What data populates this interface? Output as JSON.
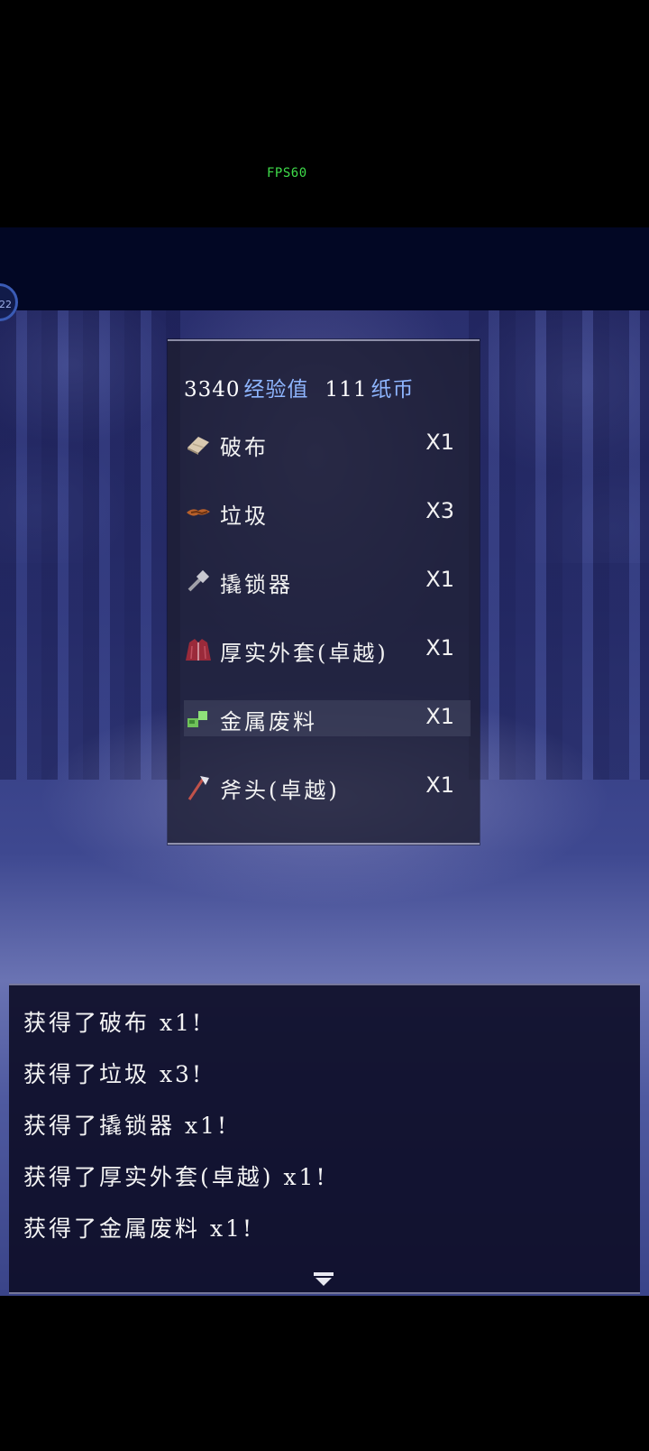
{
  "hud": {
    "fps": "FPS60",
    "menu_badge": "22"
  },
  "rewards": {
    "exp_value": "3340",
    "exp_label": "经验值",
    "money_value": "111",
    "money_label": "纸币",
    "items": [
      {
        "name": "破布",
        "qty": "X1",
        "icon": "cloth-icon"
      },
      {
        "name": "垃圾",
        "qty": "X3",
        "icon": "junk-icon"
      },
      {
        "name": "撬锁器",
        "qty": "X1",
        "icon": "lockpick-icon"
      },
      {
        "name": "厚实外套(卓越)",
        "qty": "X1",
        "icon": "coat-icon"
      },
      {
        "name": "金属废料",
        "qty": "X1",
        "icon": "scrap-metal-icon"
      },
      {
        "name": "斧头(卓越)",
        "qty": "X1",
        "icon": "axe-icon"
      }
    ]
  },
  "log": {
    "lines": [
      "获得了破布 x1!",
      "获得了垃圾 x3!",
      "获得了撬锁器 x1!",
      "获得了厚实外套(卓越) x1!",
      "获得了金属废料 x1!"
    ],
    "continue_icon": "continue-arrow-icon"
  },
  "colors": {
    "fps": "#3fdc4a",
    "currency_label": "#8fb6ff",
    "window_bg": "#1e1e30",
    "log_bg": "#0e0e28"
  }
}
